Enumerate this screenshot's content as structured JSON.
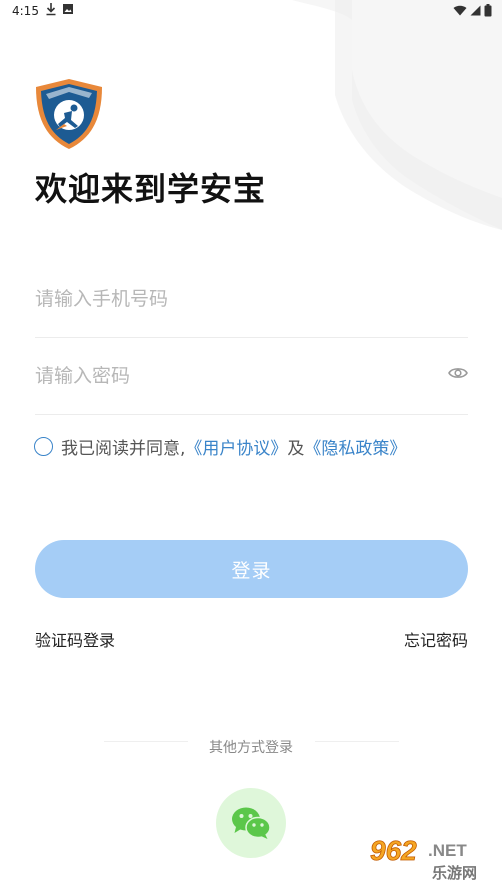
{
  "status_bar": {
    "time": "4:15"
  },
  "header": {
    "welcome_title": "欢迎来到学安宝"
  },
  "form": {
    "phone_placeholder": "请输入手机号码",
    "password_placeholder": "请输入密码"
  },
  "agreement": {
    "prefix": "我已阅读并同意,",
    "user_agreement": "《用户协议》",
    "conjunction": "及",
    "privacy_policy": "《隐私政策》",
    "checked": false
  },
  "actions": {
    "login_label": "登录",
    "sms_login_label": "验证码登录",
    "forgot_password_label": "忘记密码"
  },
  "other_login": {
    "label": "其他方式登录",
    "methods": [
      "wechat-icon"
    ]
  },
  "watermark": {
    "text": "962.NET",
    "subtext": "乐游网"
  },
  "colors": {
    "primary": "#3a84c9",
    "button_disabled": "#a5cdf6",
    "wechat_bg": "#dff7da",
    "wechat_green": "#5bc74a"
  }
}
